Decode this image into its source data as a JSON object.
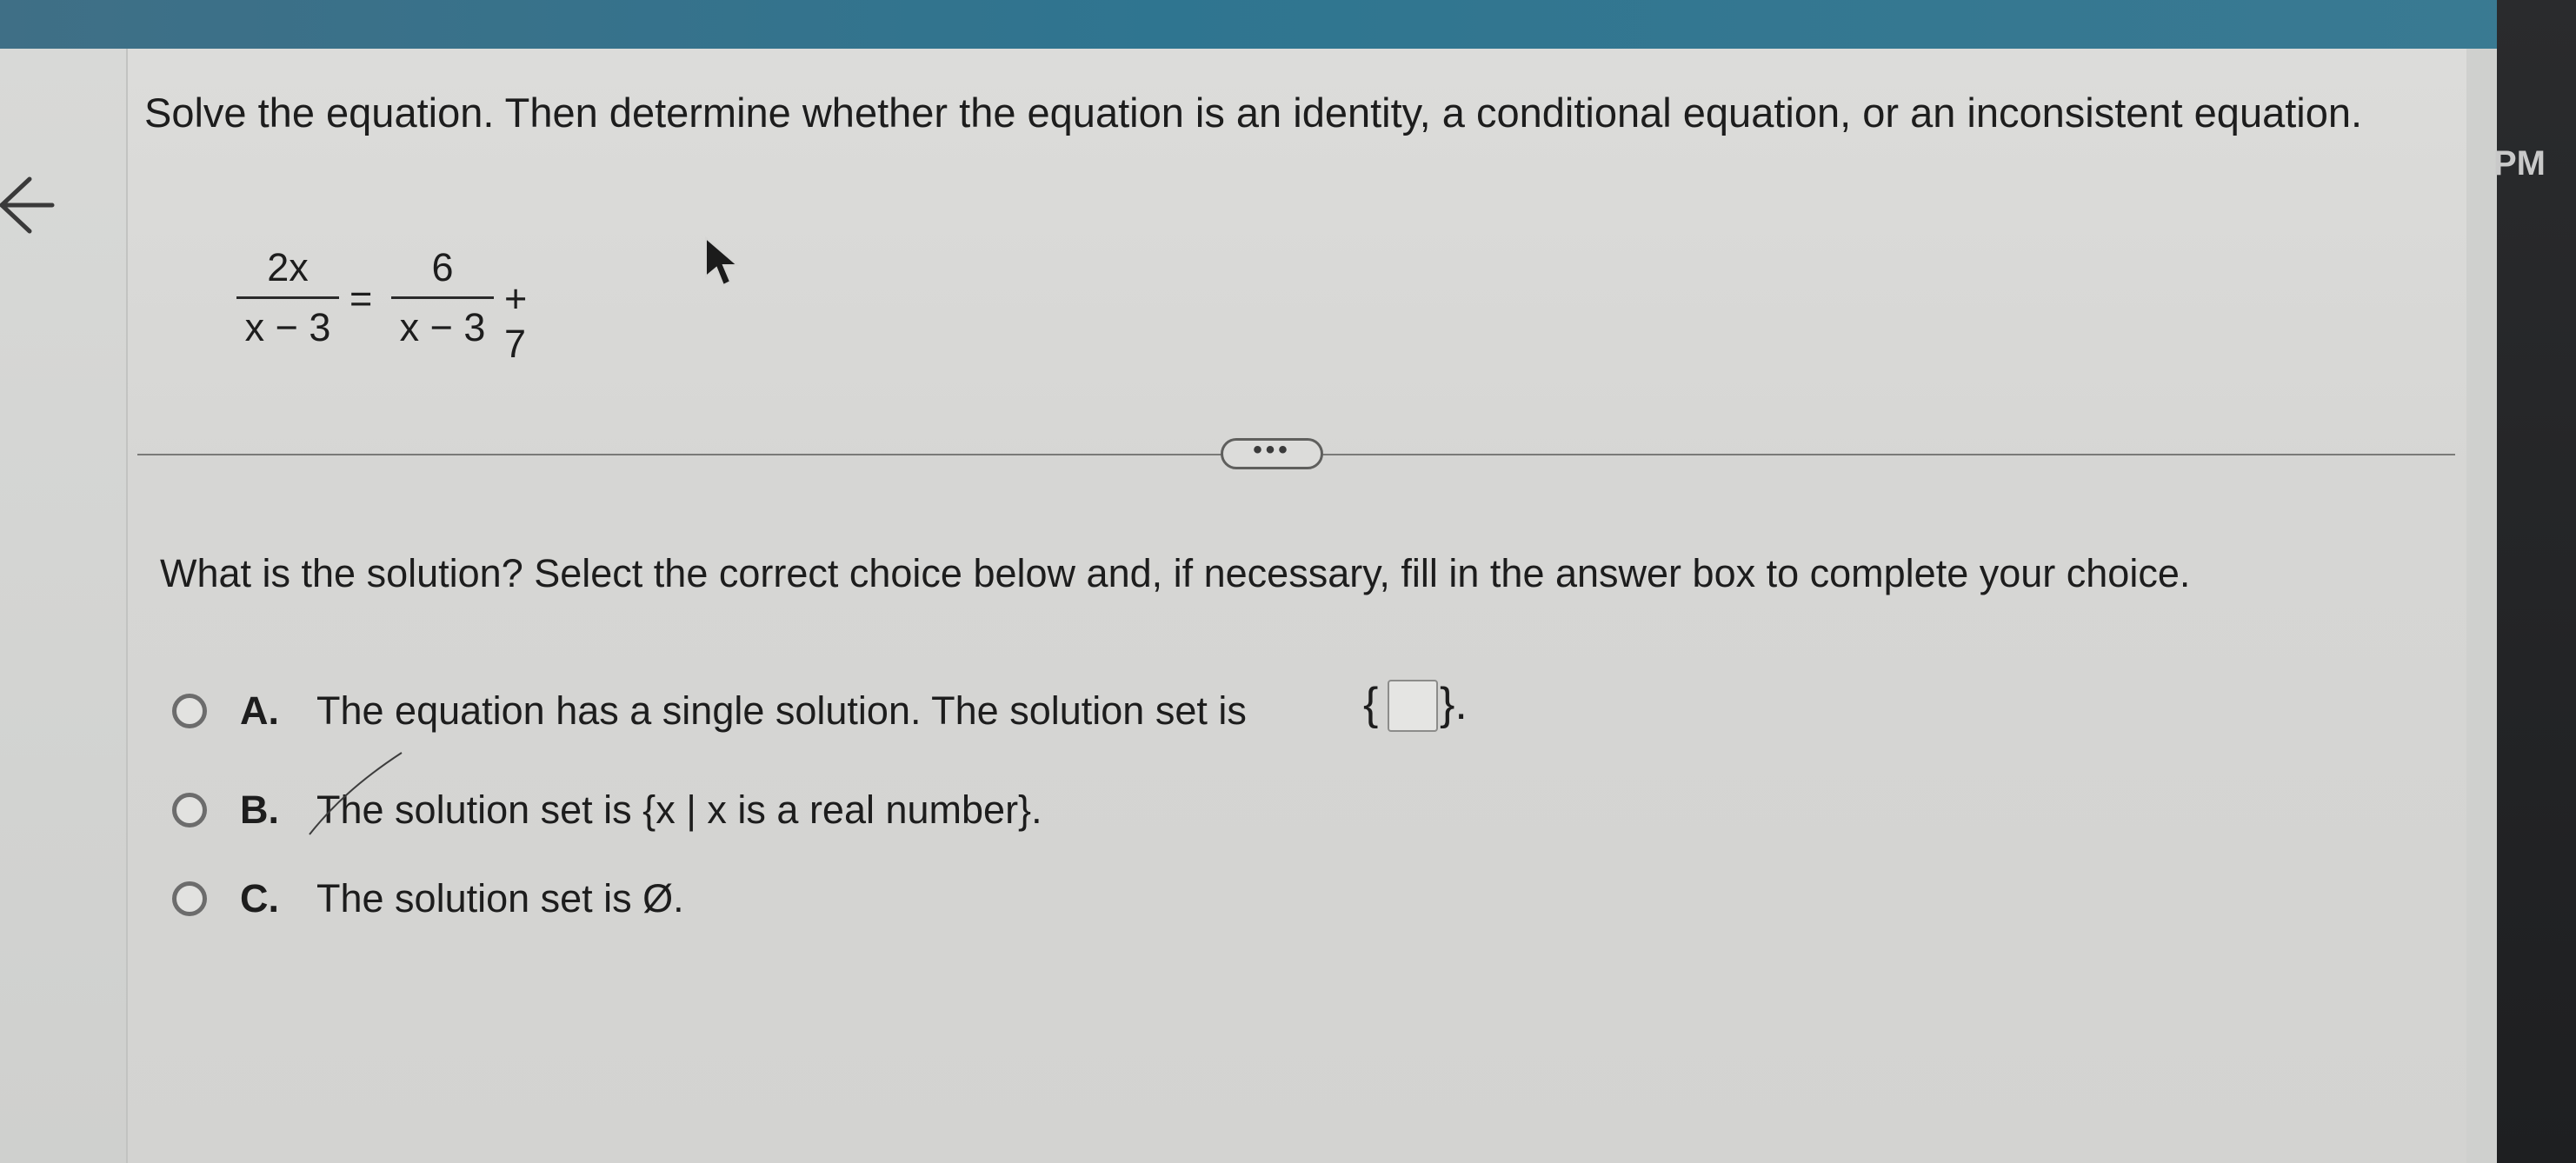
{
  "status": {
    "clock_partial": "PM"
  },
  "question": {
    "instruction": "Solve the equation. Then determine whether the equation is an identity, a conditional equation, or an inconsistent equation.",
    "equation": {
      "lhs_numerator": "2x",
      "lhs_denominator": "x − 3",
      "equals": "=",
      "rhs_numerator": "6",
      "rhs_denominator": "x − 3",
      "rhs_tail": "+ 7"
    }
  },
  "divider": {
    "more_label": "•••"
  },
  "prompt": "What is the solution? Select the correct choice below and, if necessary, fill in the answer box to complete your choice.",
  "choices": [
    {
      "letter": "A.",
      "text": "The equation has a single solution. The solution set is",
      "has_answer_box": true,
      "selected": false
    },
    {
      "letter": "B.",
      "text": "The solution set is {x | x is a real number}.",
      "selected": false
    },
    {
      "letter": "C.",
      "text": "The solution set is Ø.",
      "selected": false
    }
  ],
  "icons": {
    "back": "back-arrow-icon",
    "cursor": "mouse-pointer-icon"
  },
  "colors": {
    "top_strip": "#2f7590",
    "panel_bg": "#dcdcda",
    "text": "#1d1d1d"
  }
}
